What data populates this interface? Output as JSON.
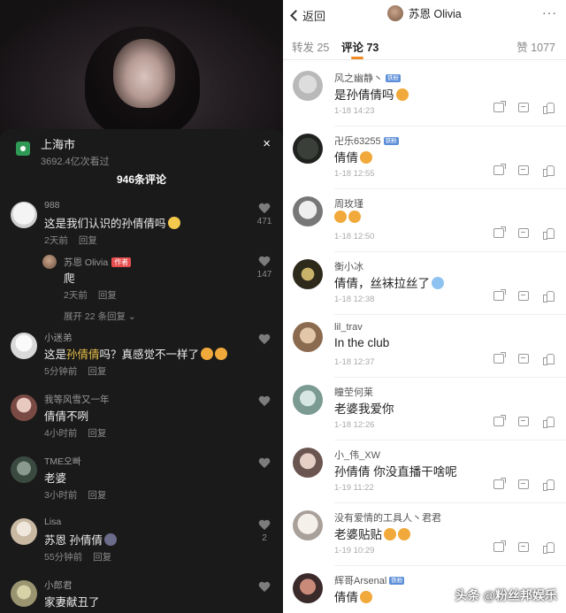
{
  "left": {
    "location": {
      "city": "上海市",
      "views": "3692.4亿次看过",
      "close": "×"
    },
    "comment_count_title": "946条评论",
    "comments": [
      {
        "user": "988",
        "text": "这是我们认识的孙倩倩吗",
        "time": "2天前",
        "reply": "回复",
        "likes": "471"
      },
      {
        "user": "苏恩 Olivia",
        "badge": "作者",
        "text": "爬",
        "time": "2天前",
        "reply": "回复",
        "likes": "147"
      },
      {
        "expand": "展开 22 条回复"
      },
      {
        "user": "小迷弟",
        "text_prefix": "这是",
        "text_highlight": "孙倩倩",
        "text_suffix": "吗？真感觉不一样了",
        "time": "5分钟前",
        "reply": "回复",
        "likes": ""
      },
      {
        "user": "我等风雪又一年",
        "text": "倩倩不咧",
        "time": "4小时前",
        "reply": "回复",
        "likes": ""
      },
      {
        "user": "TME오빠",
        "text": "老婆",
        "time": "3小时前",
        "reply": "回复",
        "likes": ""
      },
      {
        "user": "Lisa",
        "text": "苏恩 孙倩倩",
        "time": "55分钟前",
        "reply": "回复",
        "likes": "2"
      },
      {
        "user": "小郎君",
        "text": "家妻献丑了",
        "time": "",
        "reply": "",
        "likes": ""
      }
    ]
  },
  "right": {
    "topbar": {
      "back": "返回",
      "profile_name": "苏恩 Olivia",
      "more": "···"
    },
    "tabs": {
      "repost": "转发 25",
      "comments": "评论 73",
      "likes": "赞 1077"
    },
    "comments": [
      {
        "user": "风之幽静丶",
        "text": "是孙倩倩吗",
        "time": "1-18 14:23",
        "verified": "铁粉"
      },
      {
        "user": "卍乐63255",
        "text": "倩倩",
        "time": "1-18 12:55",
        "verified": "铁粉"
      },
      {
        "user": "周玫瑾",
        "text": "",
        "time": "1-18 12:50",
        "verified": ""
      },
      {
        "user": "衡小冰",
        "text": "倩倩，丝袜拉丝了",
        "time": "1-18 12:38",
        "verified": ""
      },
      {
        "user": "lil_trav",
        "text": "In the club",
        "time": "1-18 12:37",
        "verified": ""
      },
      {
        "user": "瞳茔何莱",
        "text": "老婆我爱你",
        "time": "1-18 12:26",
        "verified": ""
      },
      {
        "user": "小_伟_XW",
        "text": "孙倩倩 你没直播干啥呢",
        "time": "1-19 11:22",
        "verified": ""
      },
      {
        "user": "没有爱情的工具人丶君君",
        "text": "老婆贴贴",
        "time": "1-19 10:29",
        "verified": ""
      },
      {
        "user": "辉哥Arsenal",
        "text": "倩倩",
        "time": "",
        "verified": "铁粉"
      }
    ],
    "watermark": "头条 @粉丝邦娱乐"
  },
  "colors": {
    "accent_orange": "#f08a24",
    "author_red": "#e64d4d",
    "highlight_gold": "#e9c04a",
    "location_green": "#2e9a55"
  }
}
